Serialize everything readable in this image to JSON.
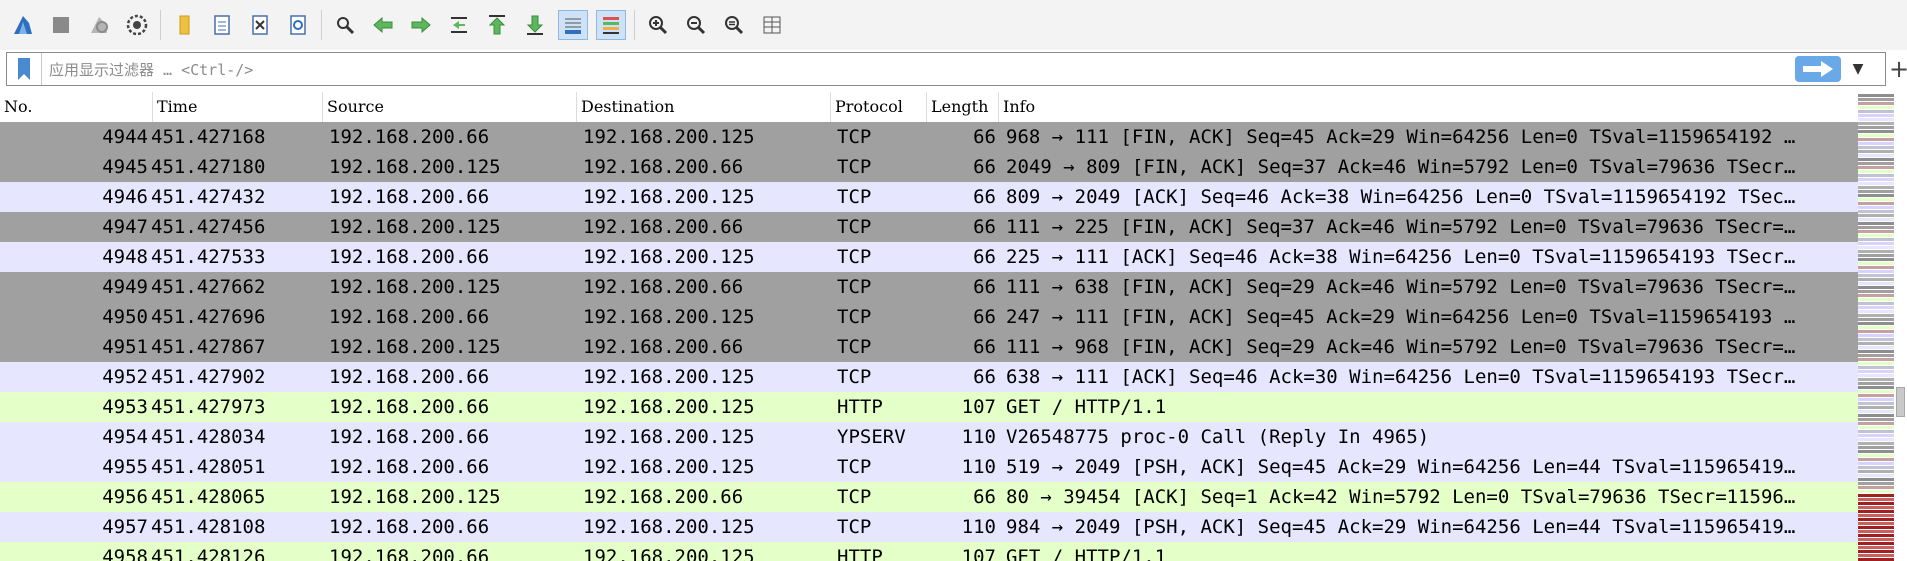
{
  "toolbar": {
    "icons": [
      "shark-fin-start-icon",
      "stop-icon",
      "restart-icon",
      "options-gear-icon",
      "open-folder-icon",
      "save-file-icon",
      "close-file-icon",
      "reload-icon",
      "find-icon",
      "go-back-icon",
      "go-forward-icon",
      "go-to-packet-icon",
      "first-packet-icon",
      "last-packet-icon",
      "autoscroll-icon",
      "colorize-icon",
      "zoom-in-icon",
      "zoom-out-icon",
      "zoom-normal-icon",
      "resize-columns-icon"
    ]
  },
  "filter": {
    "placeholder": "应用显示过滤器 … <Ctrl-/>",
    "value": "",
    "apply_icon": "arrow-right-icon",
    "dropdown_icon": "chevron-down-icon",
    "add_icon": "plus-icon"
  },
  "columns": [
    "No.",
    "Time",
    "Source",
    "Destination",
    "Protocol",
    "Length",
    "Info"
  ],
  "packets": [
    {
      "no": "4944",
      "time": "451.427168",
      "src": "192.168.200.66",
      "dst": "192.168.200.125",
      "proto": "TCP",
      "len": "66",
      "info": "968 → 111 [FIN, ACK] Seq=45 Ack=29 Win=64256 Len=0 TSval=1159654192 …",
      "bg": "#a0a0a0"
    },
    {
      "no": "4945",
      "time": "451.427180",
      "src": "192.168.200.125",
      "dst": "192.168.200.66",
      "proto": "TCP",
      "len": "66",
      "info": "2049 → 809 [FIN, ACK] Seq=37 Ack=46 Win=5792 Len=0 TSval=79636 TSecr…",
      "bg": "#a0a0a0"
    },
    {
      "no": "4946",
      "time": "451.427432",
      "src": "192.168.200.66",
      "dst": "192.168.200.125",
      "proto": "TCP",
      "len": "66",
      "info": "809 → 2049 [ACK] Seq=46 Ack=38 Win=64256 Len=0 TSval=1159654192 TSec…",
      "bg": "#e7e6ff"
    },
    {
      "no": "4947",
      "time": "451.427456",
      "src": "192.168.200.125",
      "dst": "192.168.200.66",
      "proto": "TCP",
      "len": "66",
      "info": "111 → 225 [FIN, ACK] Seq=37 Ack=46 Win=5792 Len=0 TSval=79636 TSecr=…",
      "bg": "#a0a0a0"
    },
    {
      "no": "4948",
      "time": "451.427533",
      "src": "192.168.200.66",
      "dst": "192.168.200.125",
      "proto": "TCP",
      "len": "66",
      "info": "225 → 111 [ACK] Seq=46 Ack=38 Win=64256 Len=0 TSval=1159654193 TSecr…",
      "bg": "#e7e6ff"
    },
    {
      "no": "4949",
      "time": "451.427662",
      "src": "192.168.200.125",
      "dst": "192.168.200.66",
      "proto": "TCP",
      "len": "66",
      "info": "111 → 638 [FIN, ACK] Seq=29 Ack=46 Win=5792 Len=0 TSval=79636 TSecr=…",
      "bg": "#a0a0a0"
    },
    {
      "no": "4950",
      "time": "451.427696",
      "src": "192.168.200.66",
      "dst": "192.168.200.125",
      "proto": "TCP",
      "len": "66",
      "info": "247 → 111 [FIN, ACK] Seq=45 Ack=29 Win=64256 Len=0 TSval=1159654193 …",
      "bg": "#a0a0a0"
    },
    {
      "no": "4951",
      "time": "451.427867",
      "src": "192.168.200.125",
      "dst": "192.168.200.66",
      "proto": "TCP",
      "len": "66",
      "info": "111 → 968 [FIN, ACK] Seq=29 Ack=46 Win=5792 Len=0 TSval=79636 TSecr=…",
      "bg": "#a0a0a0"
    },
    {
      "no": "4952",
      "time": "451.427902",
      "src": "192.168.200.66",
      "dst": "192.168.200.125",
      "proto": "TCP",
      "len": "66",
      "info": "638 → 111 [ACK] Seq=46 Ack=30 Win=64256 Len=0 TSval=1159654193 TSecr…",
      "bg": "#e7e6ff"
    },
    {
      "no": "4953",
      "time": "451.427973",
      "src": "192.168.200.66",
      "dst": "192.168.200.125",
      "proto": "HTTP",
      "len": "107",
      "info": "GET / HTTP/1.1",
      "bg": "#e4ffc7"
    },
    {
      "no": "4954",
      "time": "451.428034",
      "src": "192.168.200.66",
      "dst": "192.168.200.125",
      "proto": "YPSERV",
      "len": "110",
      "info": "V26548775 proc-0 Call (Reply In 4965)",
      "bg": "#e7e6ff"
    },
    {
      "no": "4955",
      "time": "451.428051",
      "src": "192.168.200.66",
      "dst": "192.168.200.125",
      "proto": "TCP",
      "len": "110",
      "info": "519 → 2049 [PSH, ACK] Seq=45 Ack=29 Win=64256 Len=44 TSval=115965419…",
      "bg": "#e7e6ff"
    },
    {
      "no": "4956",
      "time": "451.428065",
      "src": "192.168.200.125",
      "dst": "192.168.200.66",
      "proto": "TCP",
      "len": "66",
      "info": "80 → 39454 [ACK] Seq=1 Ack=42 Win=5792 Len=0 TSval=79636 TSecr=11596…",
      "bg": "#e4ffc7"
    },
    {
      "no": "4957",
      "time": "451.428108",
      "src": "192.168.200.66",
      "dst": "192.168.200.125",
      "proto": "TCP",
      "len": "110",
      "info": "984 → 2049 [PSH, ACK] Seq=45 Ack=29 Win=64256 Len=44 TSval=115965419…",
      "bg": "#e7e6ff"
    },
    {
      "no": "4958",
      "time": "451.428126",
      "src": "192.168.200.66",
      "dst": "192.168.200.125",
      "proto": "HTTP",
      "len": "107",
      "info": "GET / HTTP/1.1",
      "bg": "#e4ffc7"
    }
  ],
  "colors": {
    "fin_ack_row": "#a0a0a0",
    "tcp_row": "#e7e6ff",
    "http_row": "#e4ffc7",
    "accent": "#6aa9e8"
  }
}
